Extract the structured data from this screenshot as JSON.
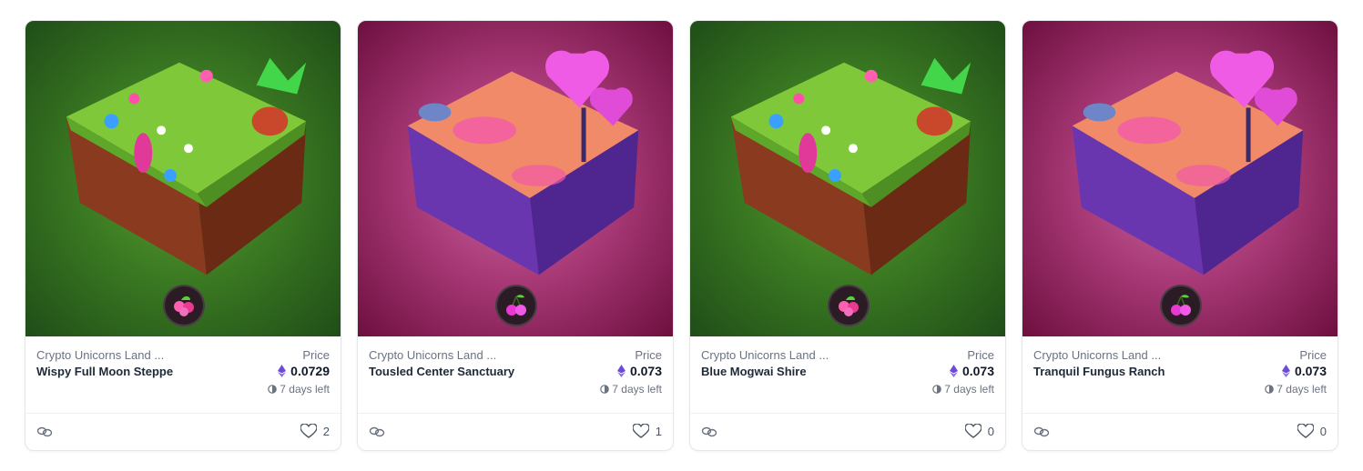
{
  "price_label": "Price",
  "time_left": "7 days left",
  "cards": [
    {
      "collection": "Crypto Unicorns Land ...",
      "name": "Wispy Full Moon Steppe",
      "price": "0.0729",
      "likes": "2",
      "theme": "green",
      "badge": "flower"
    },
    {
      "collection": "Crypto Unicorns Land ...",
      "name": "Tousled Center Sanctuary",
      "price": "0.073",
      "likes": "1",
      "theme": "pink",
      "badge": "cherry"
    },
    {
      "collection": "Crypto Unicorns Land ...",
      "name": "Blue Mogwai Shire",
      "price": "0.073",
      "likes": "0",
      "theme": "green",
      "badge": "flower"
    },
    {
      "collection": "Crypto Unicorns Land ...",
      "name": "Tranquil Fungus Ranch",
      "price": "0.073",
      "likes": "0",
      "theme": "pink",
      "badge": "cherry"
    }
  ],
  "colors": {
    "eth": "#6d4bd8",
    "green_bg": "#3b7a22",
    "pink_bg": "#a93a78"
  }
}
